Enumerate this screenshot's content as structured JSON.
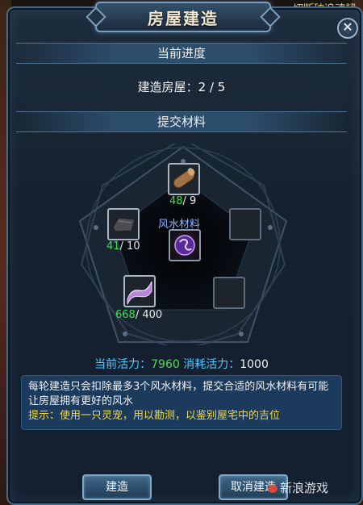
{
  "window": {
    "title": "房屋建造",
    "close_glyph": "✕"
  },
  "top_overlay_text": "一切断破追魂韧",
  "sections": {
    "progress_header": "当前进度",
    "materials_header": "提交材料"
  },
  "progress": {
    "label": "建造房屋：",
    "value": "2 / 5",
    "current": 2,
    "total": 5
  },
  "materials": [
    {
      "icon": "wood-log-icon",
      "have": "48",
      "need": "/ 9"
    },
    {
      "icon": "iron-ingot-icon",
      "have": "41",
      "need": "/ 10"
    },
    {
      "icon": "empty-slot",
      "have": "",
      "need": ""
    },
    {
      "icon": "silk-cloth-icon",
      "have": "668",
      "need": "/ 400"
    },
    {
      "icon": "empty-slot",
      "have": "",
      "need": ""
    }
  ],
  "fengshui": {
    "label": "风水材料",
    "icon": "purple-orb-icon"
  },
  "activity": {
    "current_label": "当前活力：",
    "current_value": "7960",
    "cost_label": "消耗活力：",
    "cost_value": "1000"
  },
  "description": {
    "text": "每轮建造只会扣除最多3个风水材料，提交合适的风水材料有可能让房屋拥有更好的风水",
    "tip": "提示：使用一只灵宠，用以勘测，以鉴别屋宅中的吉位"
  },
  "buttons": {
    "build": "建造",
    "cancel": "取消建造"
  },
  "watermark": "新浪游戏",
  "colors": {
    "have_count": "#3fe04a",
    "tip": "#f2d84a",
    "activity_label": "#57c8ff"
  }
}
